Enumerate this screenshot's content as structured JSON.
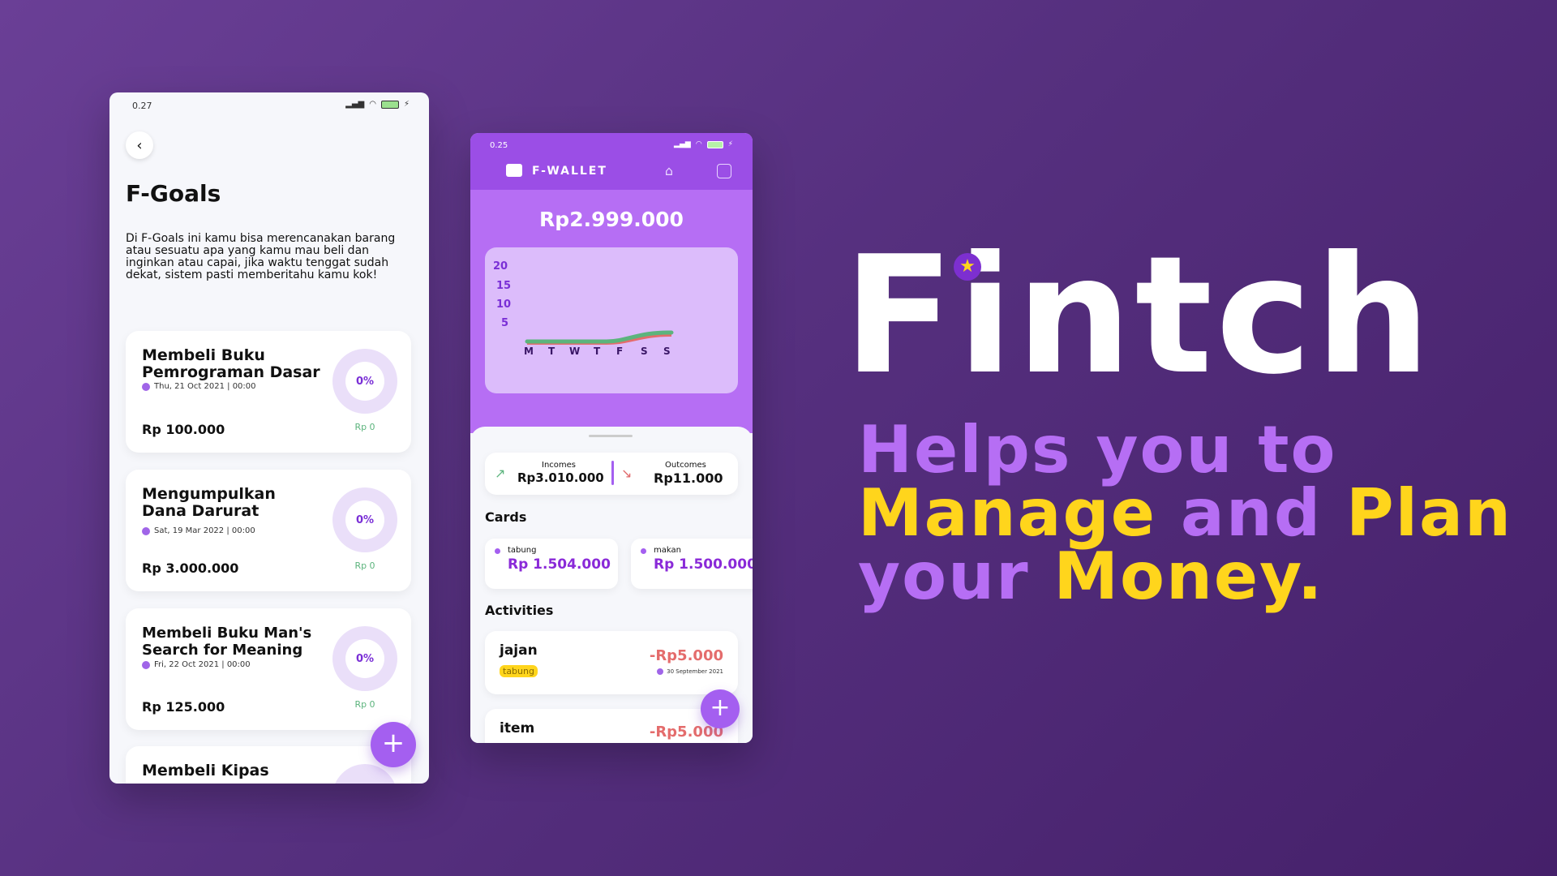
{
  "goals_phone": {
    "status_time": "0.27",
    "battery": "96",
    "title": "F-Goals",
    "description": "Di F-Goals ini kamu bisa merencanakan barang atau sesuatu apa yang kamu mau beli dan inginkan atau capai, jika waktu tenggat sudah dekat, sistem pasti memberitahu kamu kok!",
    "goals": [
      {
        "name": "Membeli Buku Pemrograman Dasar",
        "date": "Thu, 21 Oct 2021 | 00:00",
        "amount": "Rp 100.000",
        "percent": "0%",
        "saved": "Rp 0"
      },
      {
        "name": "Mengumpulkan Dana Darurat",
        "date": "Sat, 19 Mar 2022 | 00:00",
        "amount": "Rp 3.000.000",
        "percent": "0%",
        "saved": "Rp 0"
      },
      {
        "name": "Membeli Buku Man's Search for Meaning",
        "date": "Fri, 22 Oct 2021 | 00:00",
        "amount": "Rp 125.000",
        "percent": "0%",
        "saved": "Rp 0"
      },
      {
        "name": "Membeli Kipas"
      }
    ],
    "fab_label": "+"
  },
  "wallet_phone": {
    "status_time": "0.25",
    "battery": "93",
    "app_title": "F-WALLET",
    "balance": "Rp2.999.000",
    "chart_y_ticks": [
      "20",
      "15",
      "10",
      "5"
    ],
    "chart_x_days": [
      "M",
      "T",
      "W",
      "T",
      "F",
      "S",
      "S"
    ],
    "incomes_label": "Incomes",
    "incomes_value": "Rp3.010.000",
    "outcomes_label": "Outcomes",
    "outcomes_value": "Rp11.000",
    "cards_title": "Cards",
    "cards": [
      {
        "name": "tabung",
        "amount": "Rp 1.504.000"
      },
      {
        "name": "makan",
        "amount": "Rp 1.500.000"
      }
    ],
    "activities_title": "Activities",
    "activities": [
      {
        "name": "jajan",
        "tag": "tabung",
        "amount": "-Rp5.000",
        "date": "30 September 2021"
      },
      {
        "name": "item",
        "amount": "-Rp5.000"
      }
    ],
    "fab_label": "+"
  },
  "brand": {
    "name": "Fintch",
    "line1": "Helps you to",
    "line2_a": "Manage",
    "line2_b": "and",
    "line2_c": "Plan",
    "line3_a": "your",
    "line3_b": "Money."
  },
  "colors": {
    "accent_purple": "#b66ef4",
    "accent_yellow": "#ffd51c",
    "income_green": "#5cb47d",
    "expense_red": "#e46c6c"
  }
}
